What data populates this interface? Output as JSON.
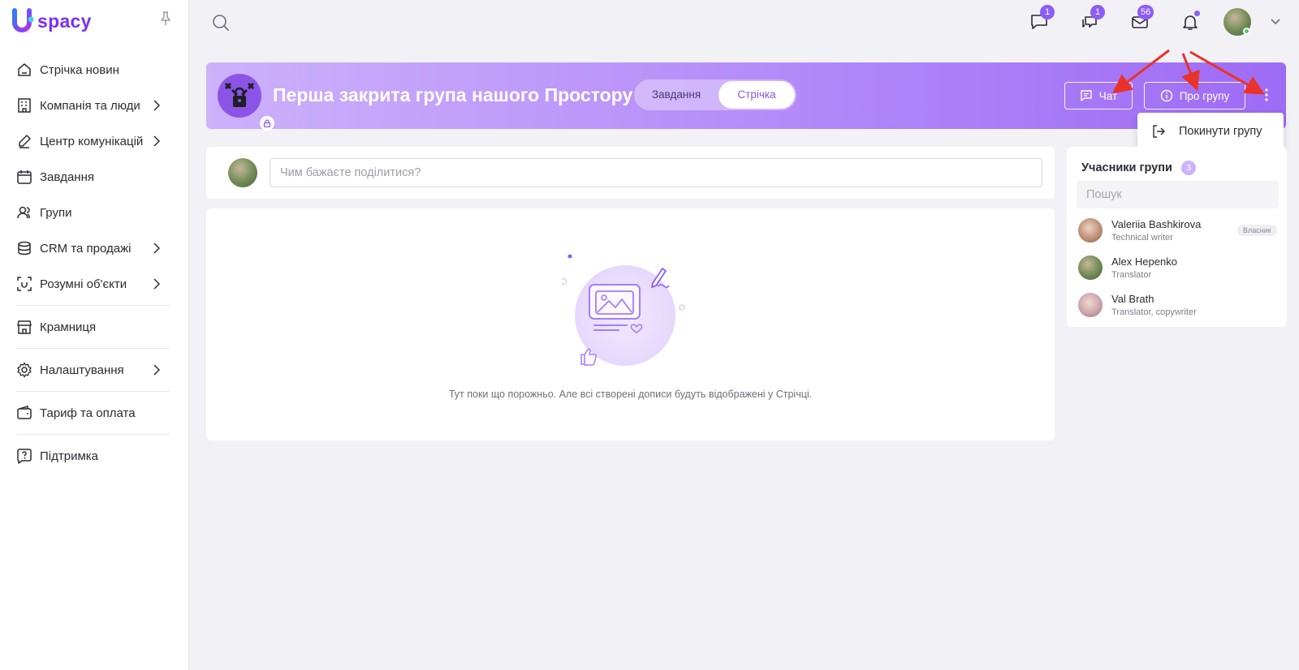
{
  "app": {
    "logo_text": "spacy",
    "brand_color": "#7b2ff2",
    "accent_color": "#8e5cf7"
  },
  "sidebar": {
    "items": [
      {
        "label": "Стрічка новин",
        "icon": "home-icon",
        "has_submenu": false
      },
      {
        "label": "Компанія та люди",
        "icon": "company-icon",
        "has_submenu": true
      },
      {
        "label": "Центр комунікацій",
        "icon": "communication-icon",
        "has_submenu": true
      },
      {
        "label": "Завдання",
        "icon": "calendar-icon",
        "has_submenu": false
      },
      {
        "label": "Групи",
        "icon": "people-icon",
        "has_submenu": false
      },
      {
        "label": "CRM та продажі",
        "icon": "crm-icon",
        "has_submenu": true
      },
      {
        "label": "Розумні об'єкти",
        "icon": "smart-objects-icon",
        "has_submenu": true
      },
      {
        "label": "Крамниця",
        "icon": "store-icon",
        "has_submenu": false
      },
      {
        "label": "Налаштування",
        "icon": "gear-icon",
        "has_submenu": true
      },
      {
        "label": "Тариф та оплата",
        "icon": "wallet-icon",
        "has_submenu": false
      },
      {
        "label": "Підтримка",
        "icon": "support-icon",
        "has_submenu": false
      }
    ]
  },
  "topbar": {
    "chat_badge": "1",
    "comments_badge": "1",
    "mail_badge": "56",
    "notifications_has_dot": true
  },
  "group": {
    "title": "Перша закрита група нашого Простору",
    "tabs": [
      {
        "label": "Завдання",
        "active": false
      },
      {
        "label": "Стрічка",
        "active": true
      }
    ],
    "chat_button": "Чат",
    "about_button": "Про групу",
    "menu": {
      "leave_label": "Покинути групу"
    }
  },
  "composer": {
    "placeholder": "Чим бажаєте поділитися?"
  },
  "feed": {
    "empty_text": "Тут поки що порожньо. Але всі створені дописи будуть відображені у Стрічці."
  },
  "members": {
    "title": "Учасники групи",
    "count": "3",
    "search_placeholder": "Пошук",
    "list": [
      {
        "name": "Valeriia Bashkirova",
        "role": "Technical writer",
        "tag": "Власник"
      },
      {
        "name": "Alex Hepenko",
        "role": "Translator",
        "tag": ""
      },
      {
        "name": "Val Brath",
        "role": "Translator, copywriter",
        "tag": ""
      }
    ]
  }
}
